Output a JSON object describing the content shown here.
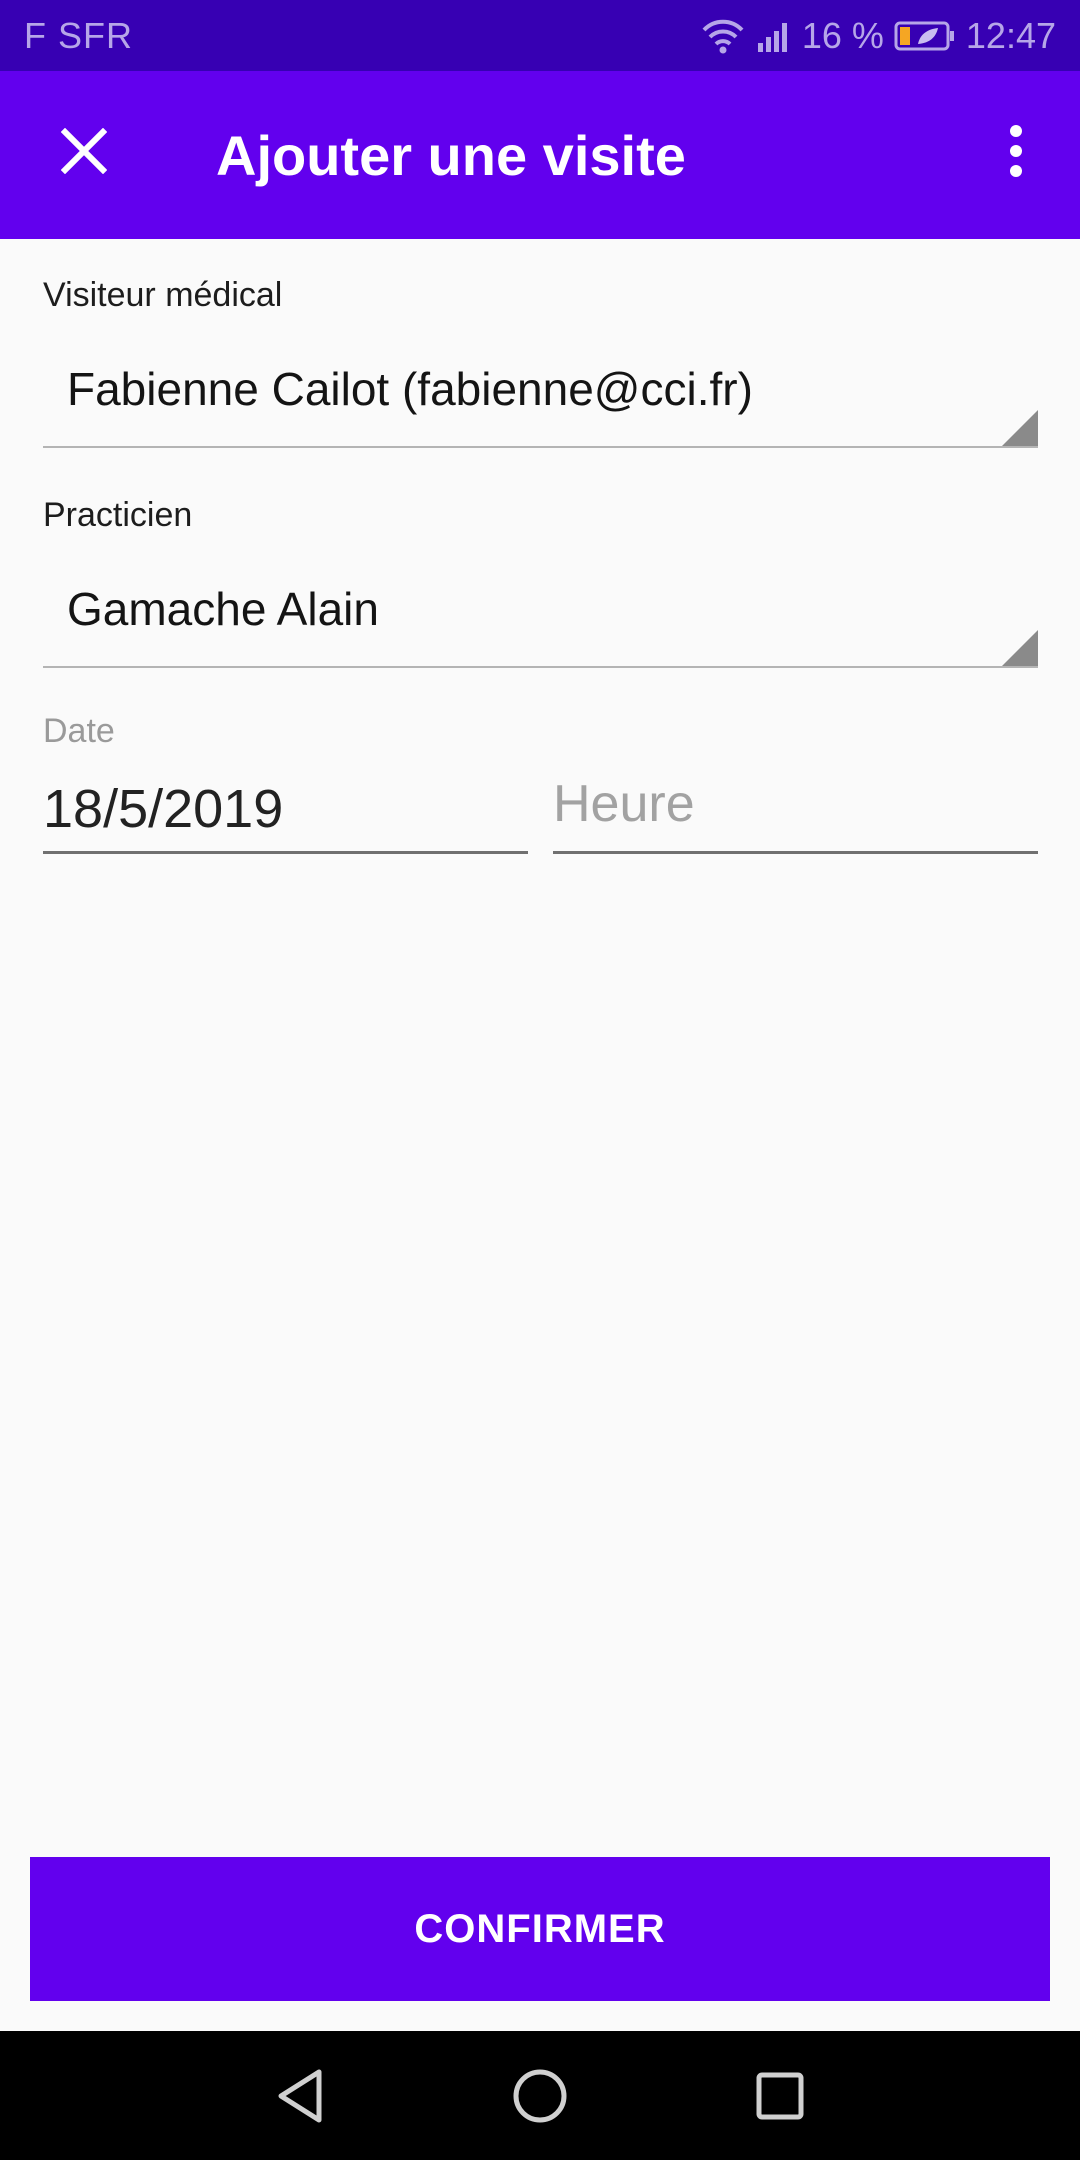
{
  "status_bar": {
    "carrier": "F SFR",
    "battery": "16 %",
    "time": "12:47",
    "icons": [
      "wifi-icon",
      "signal-icon",
      "battery-icon"
    ]
  },
  "app_bar": {
    "title": "Ajouter une visite",
    "close_icon": "close-icon",
    "menu_icon": "more-vert-icon"
  },
  "form": {
    "visitor": {
      "label": "Visiteur médical",
      "selected": "Fabienne Cailot (fabienne@cci.fr)"
    },
    "practitioner": {
      "label": "Practicien",
      "selected": "Gamache Alain"
    },
    "date": {
      "label": "Date",
      "value": "18/5/2019"
    },
    "time": {
      "placeholder": "Heure",
      "value": ""
    }
  },
  "actions": {
    "confirm_label": "CONFIRMER"
  },
  "nav_bar": {
    "icons": [
      "back-icon",
      "home-icon",
      "recents-icon"
    ]
  },
  "colors": {
    "primary": "#6200ee",
    "primary_dark": "#3700b3",
    "background": "#fafafa"
  }
}
